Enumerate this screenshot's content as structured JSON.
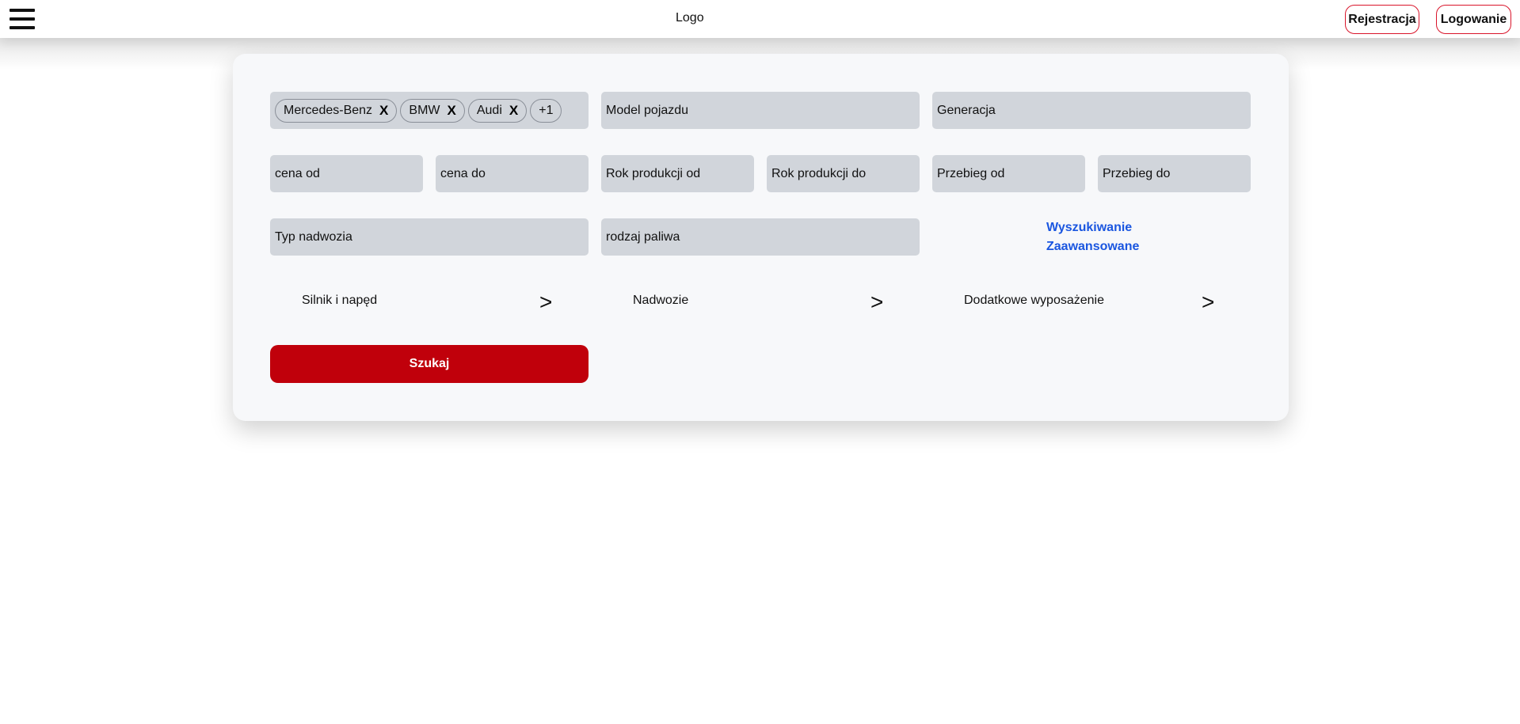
{
  "header": {
    "logo": "Logo",
    "register_label": "Rejestracja",
    "login_label": "Logowanie"
  },
  "filters": {
    "brands": {
      "chips": [
        "Mercedes-Benz",
        "BMW",
        "Audi"
      ],
      "remove_symbol": "X",
      "more": "+1"
    },
    "model_placeholder": "Model pojazdu",
    "generation_placeholder": "Generacja",
    "price_from": "cena od",
    "price_to": "cena do",
    "year_from": "Rok produkcji od",
    "year_to": "Rok produkcji do",
    "mileage_from": "Przebieg od",
    "mileage_to": "Przebieg do",
    "body_type": "Typ nadwozia",
    "fuel_type": "rodzaj paliwa",
    "advanced_search": "Wyszukiwanie Zaawansowane"
  },
  "expanders": [
    {
      "label": "Silnik i napęd",
      "arrow": ">"
    },
    {
      "label": "Nadwozie",
      "arrow": ">"
    },
    {
      "label": "Dodatkowe wyposażenie",
      "arrow": ">"
    }
  ],
  "search_button": "Szukaj",
  "colors": {
    "accent_red": "#c0000b",
    "link_blue": "#1a56e0",
    "field_gray": "#d1d5db",
    "card_bg": "#f7f8fa"
  }
}
